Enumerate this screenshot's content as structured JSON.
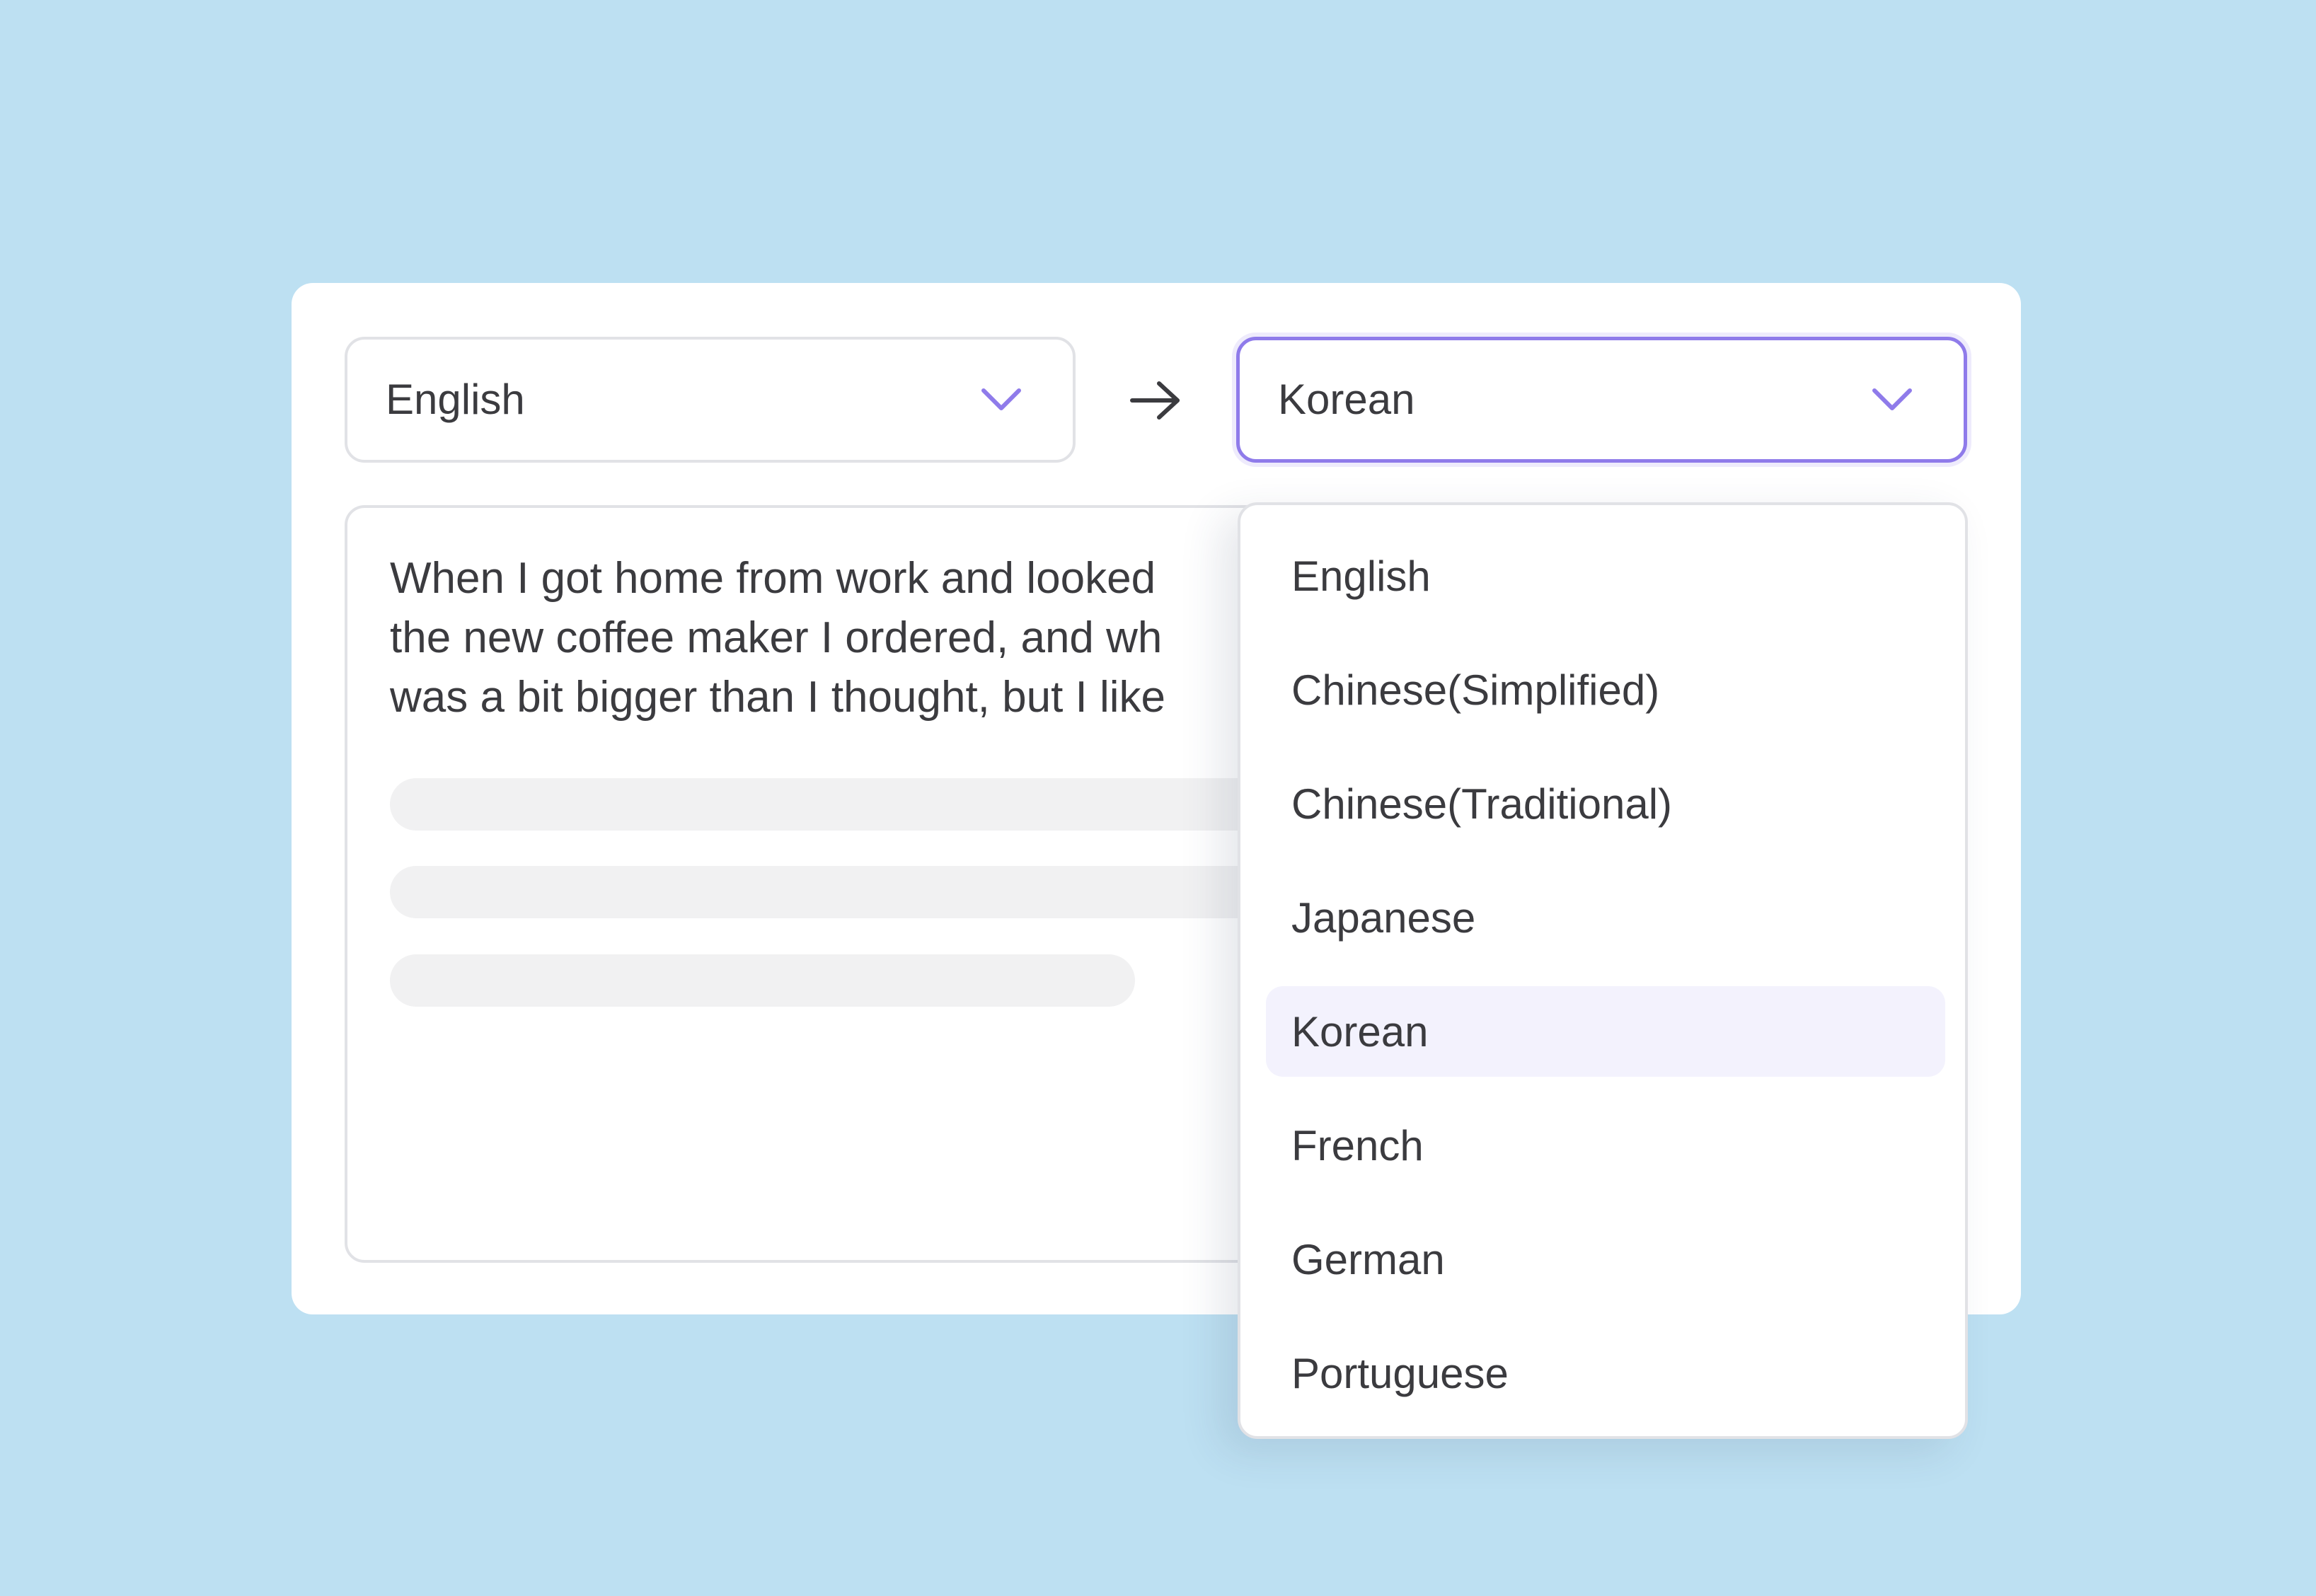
{
  "theme": {
    "background": "#BDE0F2",
    "accent": "#8F7BEA",
    "selected_option_bg": "#F3F2FD"
  },
  "source_language": {
    "value": "English",
    "icon": "chevron-down-icon"
  },
  "swap_arrow": {
    "icon": "arrow-right-icon"
  },
  "target_language": {
    "value": "Korean",
    "icon": "chevron-down-icon",
    "open": true
  },
  "source_text": {
    "lines": [
      "When I got home from work and looked",
      "the new coffee maker I ordered, and wh",
      "was a bit bigger than I thought, but I like"
    ]
  },
  "dropdown": {
    "selected": "Korean",
    "options": [
      "English",
      "Chinese(Simplified)",
      "Chinese(Traditional)",
      "Japanese",
      "Korean",
      "French",
      "German",
      "Portuguese"
    ]
  }
}
